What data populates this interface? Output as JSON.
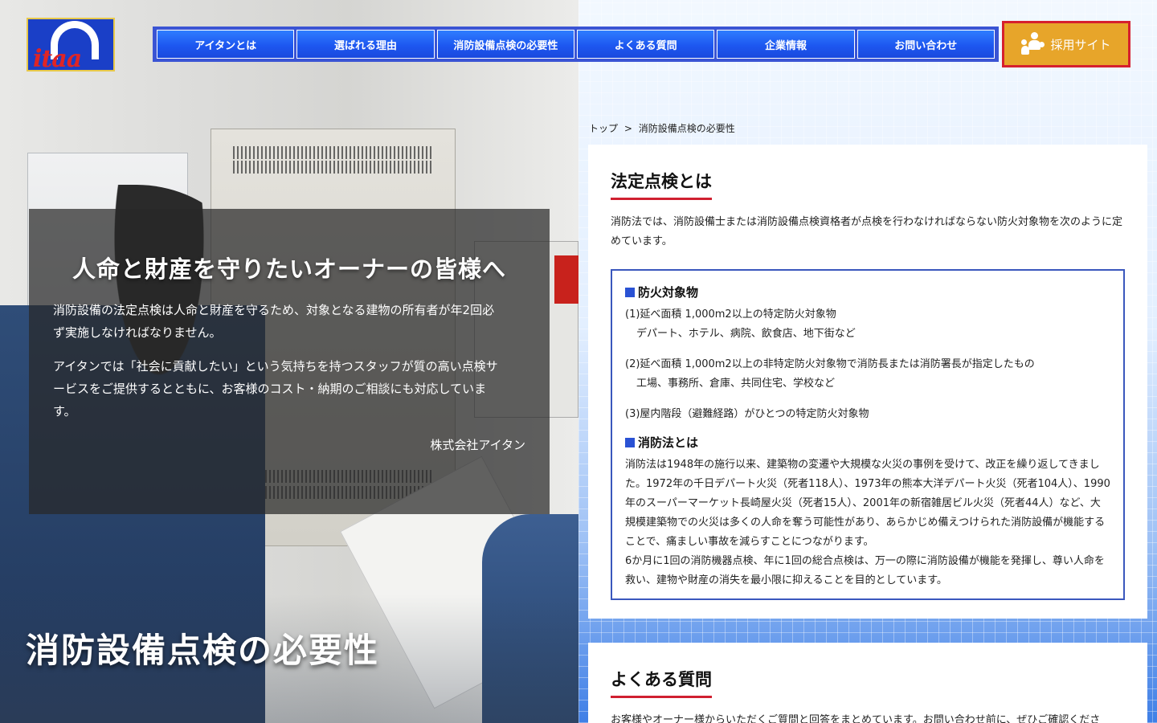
{
  "brand": {
    "logo_text": "itaa"
  },
  "nav": {
    "items": [
      {
        "label": "アイタンとは"
      },
      {
        "label": "選ばれる理由"
      },
      {
        "label": "消防設備点検の必要性"
      },
      {
        "label": "よくある質問"
      },
      {
        "label": "企業情報"
      },
      {
        "label": "お問い合わせ"
      }
    ],
    "recruit_label": "採用サイト"
  },
  "hero": {
    "heading": "人命と財産を守りたいオーナーの皆様へ",
    "para1": "消防設備の法定点検は人命と財産を守るため、対象となる建物の所有者が年2回必ず実施しなければなりません。",
    "para2": "アイタンでは「社会に貢献したい」という気持ちを持つスタッフが質の高い点検サービスをご提供するとともに、お客様のコスト・納期のご相談にも対応しています。",
    "signature": "株式会社アイタン",
    "page_title": "消防設備点検の必要性"
  },
  "breadcrumb": {
    "home": "トップ",
    "sep": ">",
    "current": "消防設備点検の必要性"
  },
  "section1": {
    "title": "法定点検とは",
    "lead": "消防法では、消防設備士または消防設備点検資格者が点検を行わなければならない防火対象物を次のように定めています。",
    "box_title1": "防火対象物",
    "item1_main": "(1)延べ面積 1,000m2以上の特定防火対象物",
    "item1_sub": "デパート、ホテル、病院、飲食店、地下街など",
    "item2_main": "(2)延べ面積 1,000m2以上の非特定防火対象物で消防長または消防署長が指定したもの",
    "item2_sub": "工場、事務所、倉庫、共同住宅、学校など",
    "item3_main": "(3)屋内階段（避難経路）がひとつの特定防火対象物",
    "box_title2": "消防法とは",
    "law_para1": "消防法は1948年の施行以来、建築物の変遷や大規模な火災の事例を受けて、改正を繰り返してきました。1972年の千日デパート火災（死者118人）、1973年の熊本大洋デパート火災（死者104人）、1990年のスーパーマーケット長崎屋火災（死者15人）、2001年の新宿雑居ビル火災（死者44人）など、大規模建築物での火災は多くの人命を奪う可能性があり、あらかじめ備えつけられた消防設備が機能することで、痛ましい事故を減らすことにつながります。",
    "law_para2": "6か月に1回の消防機器点検、年に1回の総合点検は、万一の際に消防設備が機能を発揮し、尊い人命を救い、建物や財産の消失を最小限に抑えることを目的としています。"
  },
  "section2": {
    "title": "よくある質問",
    "lead": "お客様やオーナー様からいただくご質問と回答をまとめています。お問い合わせ前に、ぜひご確認くださ"
  },
  "colors": {
    "nav_blue": "#1d57f0",
    "recruit_orange": "#e7a52a",
    "accent_red": "#d02030",
    "box_blue": "#3a57bd"
  }
}
